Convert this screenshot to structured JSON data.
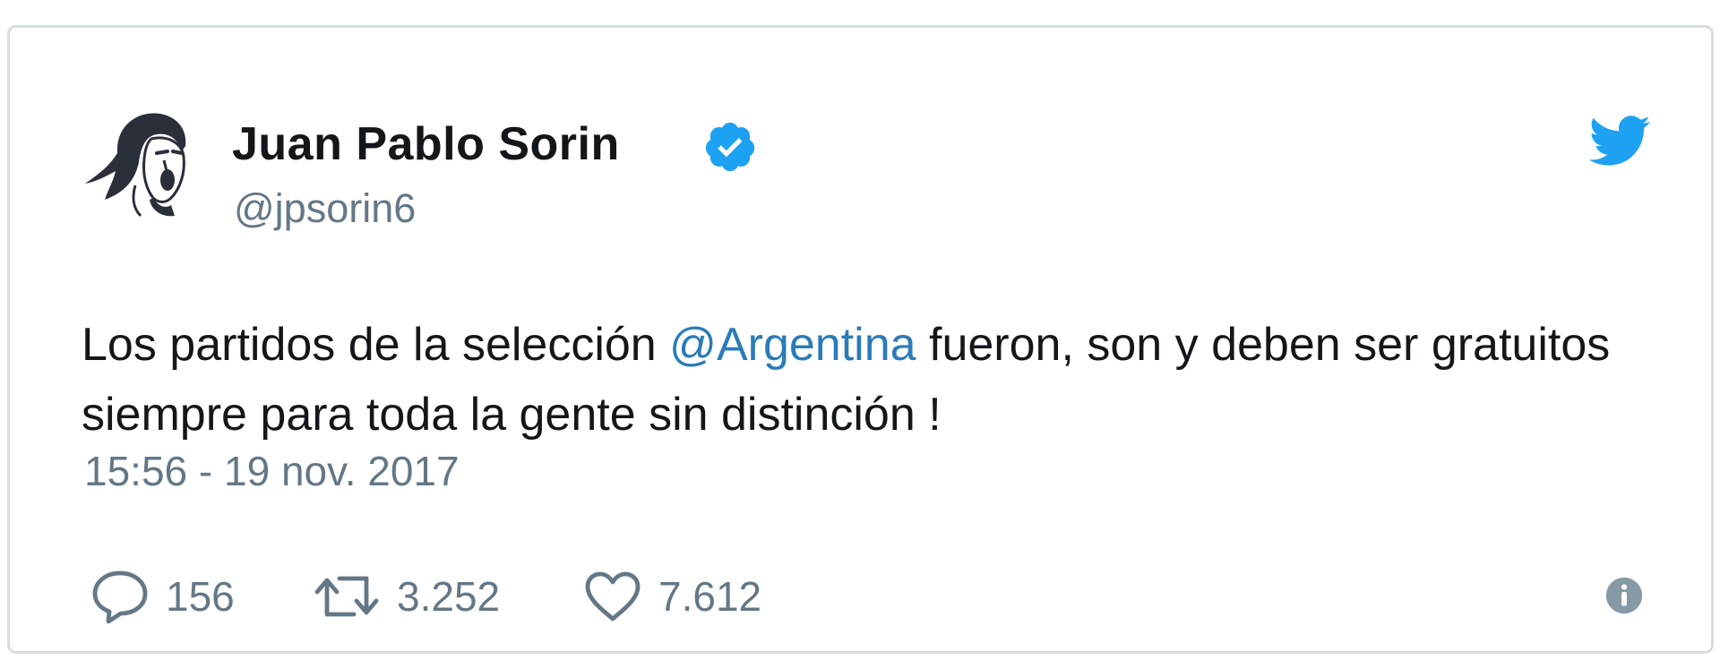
{
  "author": {
    "display_name": "Juan Pablo Sorin",
    "handle": "@jpsorin6",
    "verified": true,
    "avatar_icon": "avatar-portrait"
  },
  "brand_icon": "twitter-bird-icon",
  "tweet": {
    "text_before": "Los partidos de la selección ",
    "mention": "@Argentina",
    "text_after": " fueron, son y deben ser gratuitos siempre para toda la gente sin distinción !",
    "timestamp": "15:56 - 19 nov. 2017"
  },
  "actions": {
    "replies": "156",
    "retweets": "3.252",
    "likes": "7.612"
  },
  "colors": {
    "brand_blue": "#1da1f2",
    "mention_blue": "#2b7bb9",
    "text_dark": "#14171a",
    "text_gray": "#657786",
    "border": "#d6dde3"
  }
}
